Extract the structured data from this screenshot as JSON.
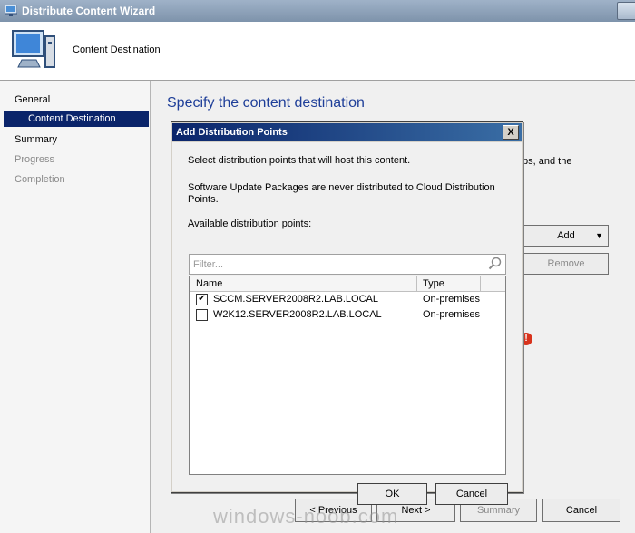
{
  "window": {
    "title": "Distribute Content Wizard",
    "header_title": "Content Destination"
  },
  "nav": {
    "items": [
      {
        "label": "General",
        "state": "normal"
      },
      {
        "label": "Content Destination",
        "state": "selected"
      },
      {
        "label": "Summary",
        "state": "normal"
      },
      {
        "label": "Progress",
        "state": "disabled"
      },
      {
        "label": "Completion",
        "state": "disabled"
      }
    ]
  },
  "page": {
    "heading": "Specify the content destination",
    "partial_text": "ps, and the",
    "add_label": "Add",
    "remove_label": "Remove"
  },
  "footer": {
    "previous_label": "< Previous",
    "next_label": "Next >",
    "summary_label": "Summary",
    "cancel_label": "Cancel"
  },
  "watermark": "windows-noob.com",
  "dialog": {
    "title": "Add Distribution Points",
    "close_label": "X",
    "instruction": "Select distribution points that will host this content.",
    "note": "Software Update Packages are never distributed to Cloud Distribution Points.",
    "list_label": "Available distribution points:",
    "filter_placeholder": "Filter...",
    "columns": {
      "name": "Name",
      "type": "Type"
    },
    "rows": [
      {
        "name": "SCCM.SERVER2008R2.LAB.LOCAL",
        "type": "On-premises",
        "checked": true
      },
      {
        "name": "W2K12.SERVER2008R2.LAB.LOCAL",
        "type": "On-premises",
        "checked": false
      }
    ],
    "ok_label": "OK",
    "cancel_label": "Cancel"
  },
  "colors": {
    "heading": "#1f3f99",
    "selection": "#0a246a",
    "error": "#d8331c"
  },
  "icons": [
    "wizard-icon",
    "computer-icon",
    "dropdown-arrow-icon",
    "error-icon",
    "close-icon",
    "search-icon",
    "checkbox-icon"
  ]
}
